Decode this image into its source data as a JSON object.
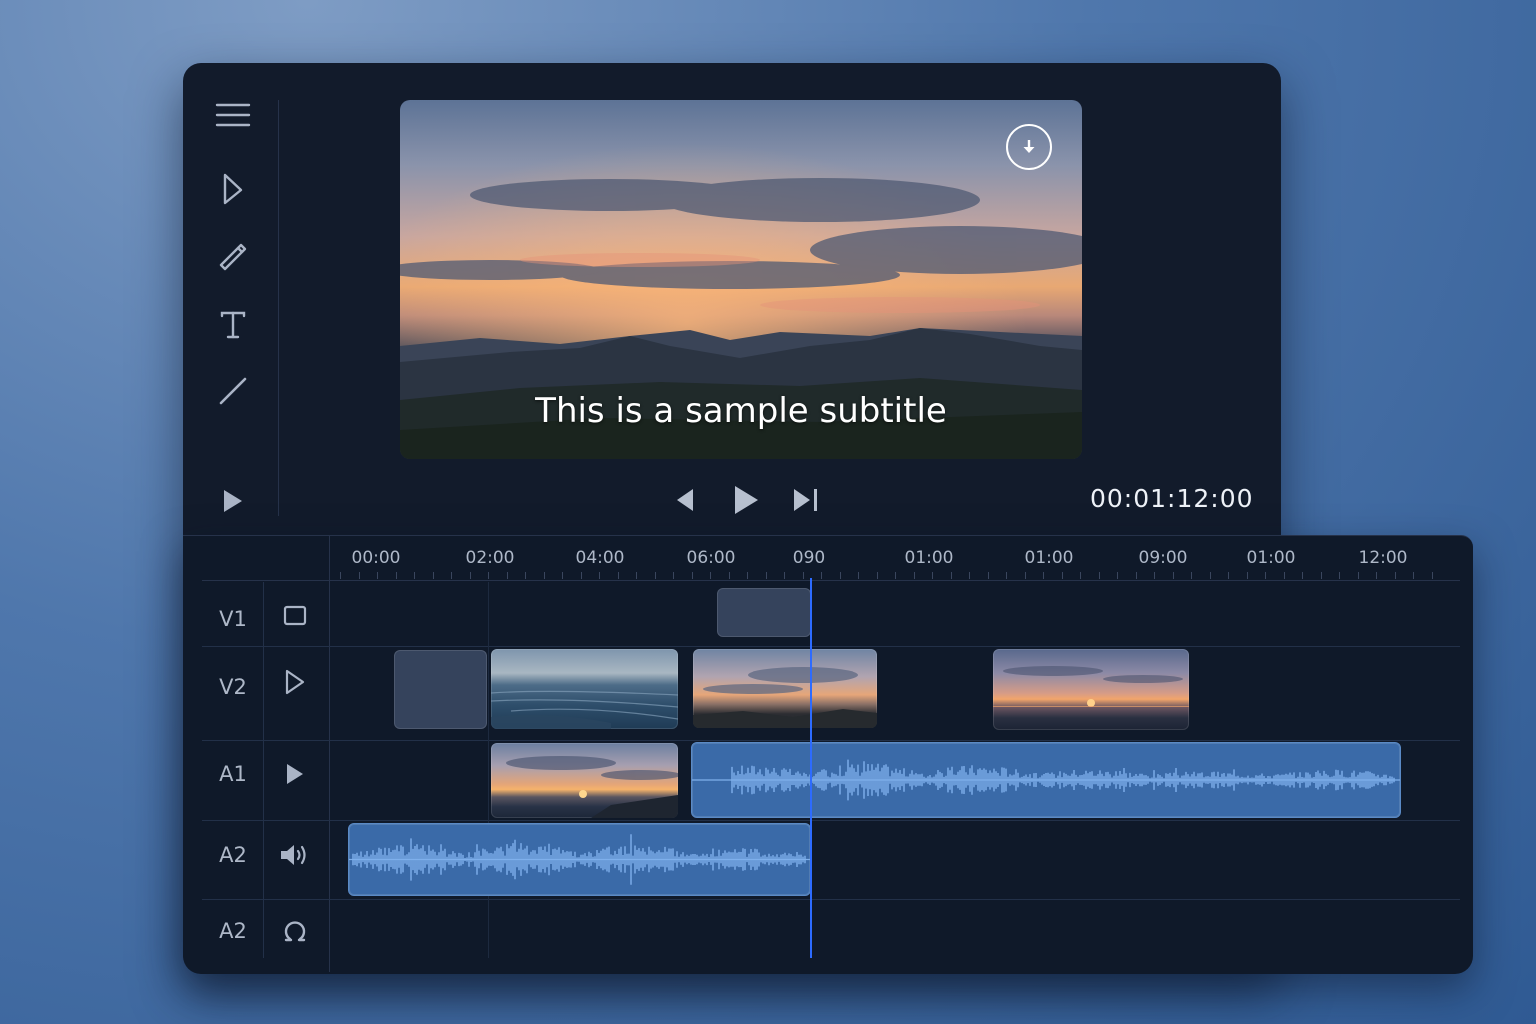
{
  "app": {
    "tools": [
      {
        "name": "menu-icon"
      },
      {
        "name": "select-arrow-icon"
      },
      {
        "name": "pen-icon"
      },
      {
        "name": "text-tool-icon"
      },
      {
        "name": "line-tool-icon"
      },
      {
        "name": "play-icon"
      }
    ]
  },
  "preview": {
    "subtitle": "This is a sample subtitle",
    "download_icon": "download-circle-icon"
  },
  "transport": {
    "prev_icon": "previous-frame-icon",
    "play_icon": "play-icon",
    "next_icon": "skip-to-end-icon",
    "timecode": "00:01:12:00"
  },
  "timeline": {
    "ruler_labels": [
      "00:00",
      "02:00",
      "04:00",
      "06:00",
      "090",
      "01:00",
      "01:00",
      "09:00",
      "01:00",
      "12:00"
    ],
    "tracks": [
      {
        "label": "V1",
        "icon": "square-icon"
      },
      {
        "label": "V2",
        "icon": "play-outline-icon"
      },
      {
        "label": "A1",
        "icon": "play-filled-icon"
      },
      {
        "label": "A2",
        "icon": "speaker-icon"
      },
      {
        "label": "A2",
        "icon": "loop-icon"
      }
    ],
    "colors": {
      "playhead": "#2d6bff",
      "audio_clip": "#3a6aa8",
      "waveform": "#7fb0ec"
    }
  }
}
